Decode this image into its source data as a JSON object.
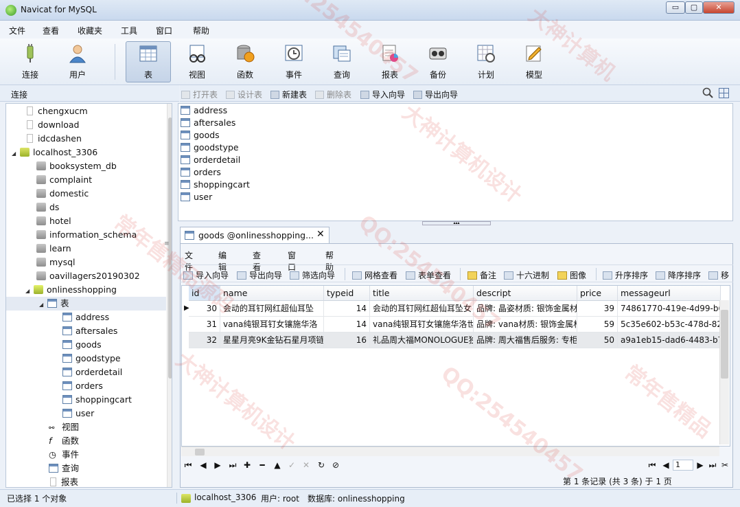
{
  "window": {
    "title": "Navicat for MySQL",
    "minimize": "▭",
    "maximize": "▢",
    "close": "✕"
  },
  "menu": [
    "文件",
    "查看",
    "收藏夹",
    "工具",
    "窗口",
    "帮助"
  ],
  "toolbar": {
    "connect": "连接",
    "user": "用户",
    "table": "表",
    "view": "视图",
    "function": "函数",
    "event": "事件",
    "query": "查询",
    "report": "报表",
    "backup": "备份",
    "schedule": "计划",
    "model": "模型"
  },
  "left_header": "连接",
  "tree": {
    "connections": [
      "chengxucm",
      "download",
      "idcdashen"
    ],
    "host": "localhost_3306",
    "databases": [
      "booksystem_db",
      "complaint",
      "domestic",
      "ds",
      "hotel",
      "information_schema",
      "learn",
      "mysql",
      "oavillagers20190302"
    ],
    "open_db": "onlinesshopping",
    "tables_node": "表",
    "tables": [
      "address",
      "aftersales",
      "goods",
      "goodstype",
      "orderdetail",
      "orders",
      "shoppingcart",
      "user"
    ],
    "view_node": "视图",
    "function_node": "函数",
    "event_node": "事件",
    "query_node": "查询",
    "report_node": "报表"
  },
  "obj_toolbar": {
    "open": "打开表",
    "design": "设计表",
    "new": "新建表",
    "delete": "删除表",
    "import": "导入向导",
    "export": "导出向导"
  },
  "object_list": [
    "address",
    "aftersales",
    "goods",
    "goodstype",
    "orderdetail",
    "orders",
    "shoppingcart",
    "user"
  ],
  "tab": {
    "title": "goods @onlinesshopping...",
    "close": "✕"
  },
  "inner_menu": [
    "文件",
    "编辑",
    "查看",
    "窗口",
    "帮助"
  ],
  "inner_toolbar": {
    "import": "导入向导",
    "export": "导出向导",
    "filter": "筛选向导",
    "grid": "网格查看",
    "form": "表单查看",
    "memo": "备注",
    "hex": "十六进制",
    "image": "图像",
    "asc": "升序排序",
    "desc": "降序排序",
    "more": "移"
  },
  "grid": {
    "columns": [
      "id",
      "name",
      "typeid",
      "title",
      "descript",
      "price",
      "messageurl"
    ],
    "rows": [
      [
        "30",
        "会动的耳钉网红超仙耳坠",
        "14",
        "会动的耳钉网红超仙耳坠女",
        "品牌: 晶姿材质: 银饰金属材",
        "39",
        "74861770-419e-4d99-b6"
      ],
      [
        "31",
        "vana纯银耳钉女镶施华洛",
        "14",
        "vana纯银耳钉女镶施华洛世",
        "品牌: vana材质: 银饰金属材",
        "59",
        "5c35e602-b53c-478d-82"
      ],
      [
        "32",
        "星星月亮9K金钻石星月项链",
        "16",
        "礼品周大福MONOLOGUE独",
        "品牌: 周大福售后服务: 专柜",
        "50",
        "a9a1eb15-dad6-4483-b7"
      ]
    ]
  },
  "nav": {
    "page": "1"
  },
  "record_info": "第 1 条记录 (共 3 条) 于 1 页",
  "status": {
    "selection": "已选择 1 个对象",
    "host": "localhost_3306",
    "user": "用户: root",
    "database": "数据库: onlinesshopping"
  }
}
